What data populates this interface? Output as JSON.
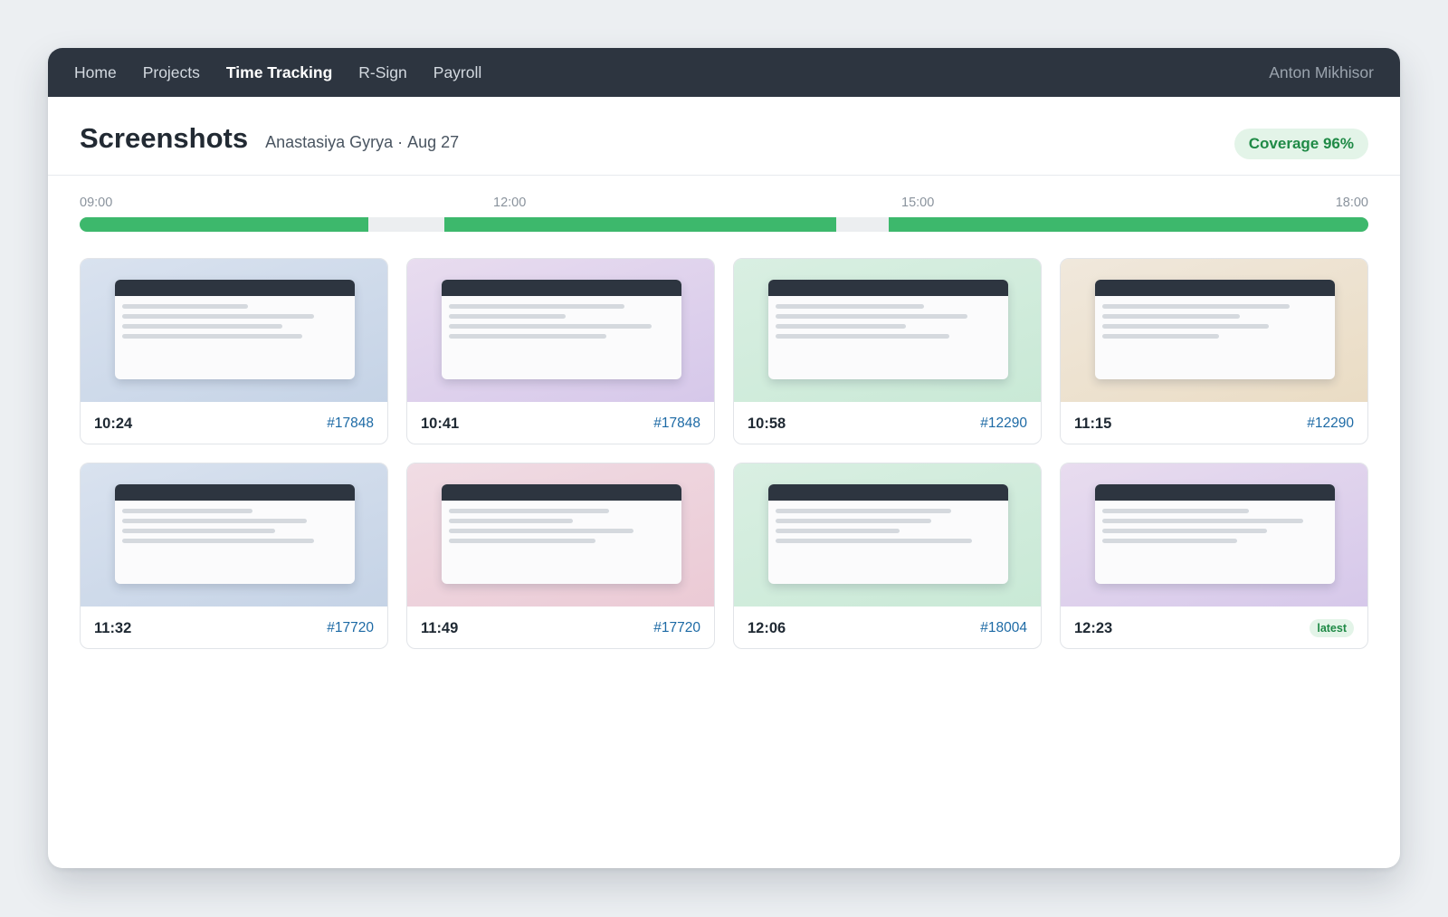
{
  "nav": {
    "items": [
      {
        "label": "Home",
        "active": false
      },
      {
        "label": "Projects",
        "active": false
      },
      {
        "label": "Time Tracking",
        "active": true
      },
      {
        "label": "R-Sign",
        "active": false
      },
      {
        "label": "Payroll",
        "active": false
      }
    ],
    "user": "Anton Mikhisor"
  },
  "header": {
    "title": "Screenshots",
    "person": "Anastasiya Gyrya",
    "separator": "·",
    "date": "Aug 27",
    "coverage": "Coverage 96%"
  },
  "timeline": {
    "ticks": [
      "09:00",
      "12:00",
      "15:00",
      "18:00"
    ],
    "active_color": "#3db86c",
    "segments": [
      {
        "start": "09:00",
        "end": "11:01"
      },
      {
        "start": "11:33",
        "end": "14:17"
      },
      {
        "start": "14:39",
        "end": "18:00"
      }
    ]
  },
  "screenshots": [
    {
      "time": "10:24",
      "ticket": "#17848",
      "bg": [
        "#d9e2ef",
        "#c5d3e6"
      ],
      "lines": [
        0.56,
        0.85,
        0.71,
        0.8
      ]
    },
    {
      "time": "10:41",
      "ticket": "#17848",
      "bg": [
        "#e8dcef",
        "#d6c8ea"
      ],
      "lines": [
        0.78,
        0.52,
        0.9,
        0.7
      ]
    },
    {
      "time": "10:58",
      "ticket": "#12290",
      "bg": [
        "#d9efe2",
        "#c9e9d6"
      ],
      "lines": [
        0.66,
        0.85,
        0.58,
        0.77
      ]
    },
    {
      "time": "11:15",
      "ticket": "#12290",
      "bg": [
        "#f0e8dc",
        "#eadcc4"
      ],
      "lines": [
        0.83,
        0.61,
        0.74,
        0.52
      ]
    },
    {
      "time": "11:32",
      "ticket": "#17720",
      "bg": [
        "#d9e2ef",
        "#c5d3e6"
      ],
      "lines": [
        0.58,
        0.82,
        0.68,
        0.85
      ]
    },
    {
      "time": "11:49",
      "ticket": "#17720",
      "bg": [
        "#f0dce4",
        "#ebcad5"
      ],
      "lines": [
        0.71,
        0.55,
        0.82,
        0.65
      ]
    },
    {
      "time": "12:06",
      "ticket": "#18004",
      "bg": [
        "#d9efe2",
        "#c9e9d6"
      ],
      "lines": [
        0.78,
        0.69,
        0.55,
        0.87
      ]
    },
    {
      "time": "12:23",
      "ticket": "latest",
      "is_latest": true,
      "bg": [
        "#e8dcef",
        "#d6c8ea"
      ],
      "lines": [
        0.65,
        0.89,
        0.73,
        0.6
      ]
    }
  ]
}
